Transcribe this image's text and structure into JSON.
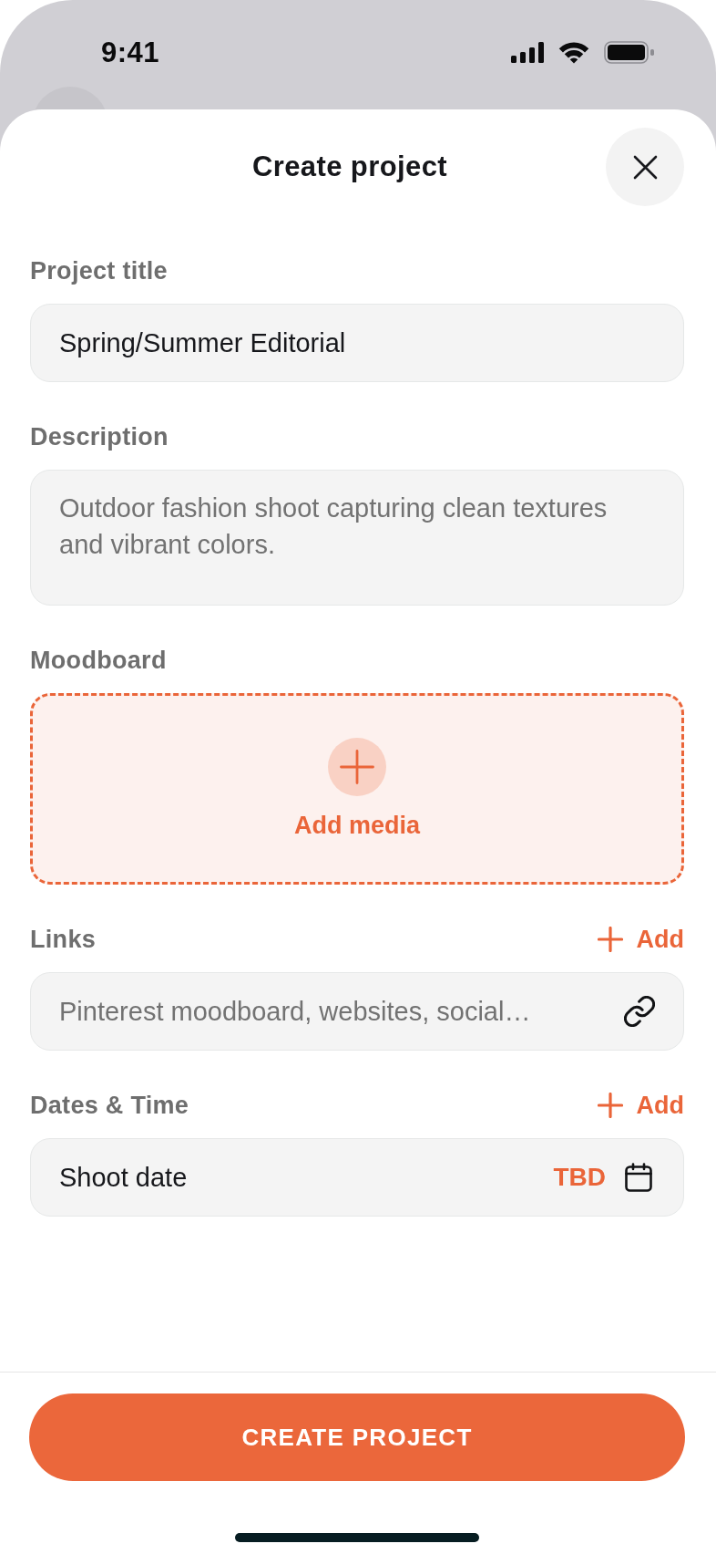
{
  "status_bar": {
    "time": "9:41"
  },
  "sheet": {
    "title": "Create project"
  },
  "fields": [
    {
      "kind": "text",
      "label": "Project title",
      "value": "Spring/Summer Editorial"
    },
    {
      "kind": "textarea",
      "label": "Description",
      "placeholder": "Outdoor fashion shoot capturing clean textures and vibrant colors."
    },
    {
      "kind": "dropzone",
      "label": "Moodboard",
      "action": "Add media"
    },
    {
      "kind": "link",
      "label": "Links",
      "add_label": "Add",
      "placeholder": "Pinterest moodboard, websites, social…"
    },
    {
      "kind": "date",
      "label": "Dates & Time",
      "add_label": "Add",
      "item": "Shoot date",
      "value": "TBD"
    }
  ],
  "primary_button": "CREATE PROJECT"
}
